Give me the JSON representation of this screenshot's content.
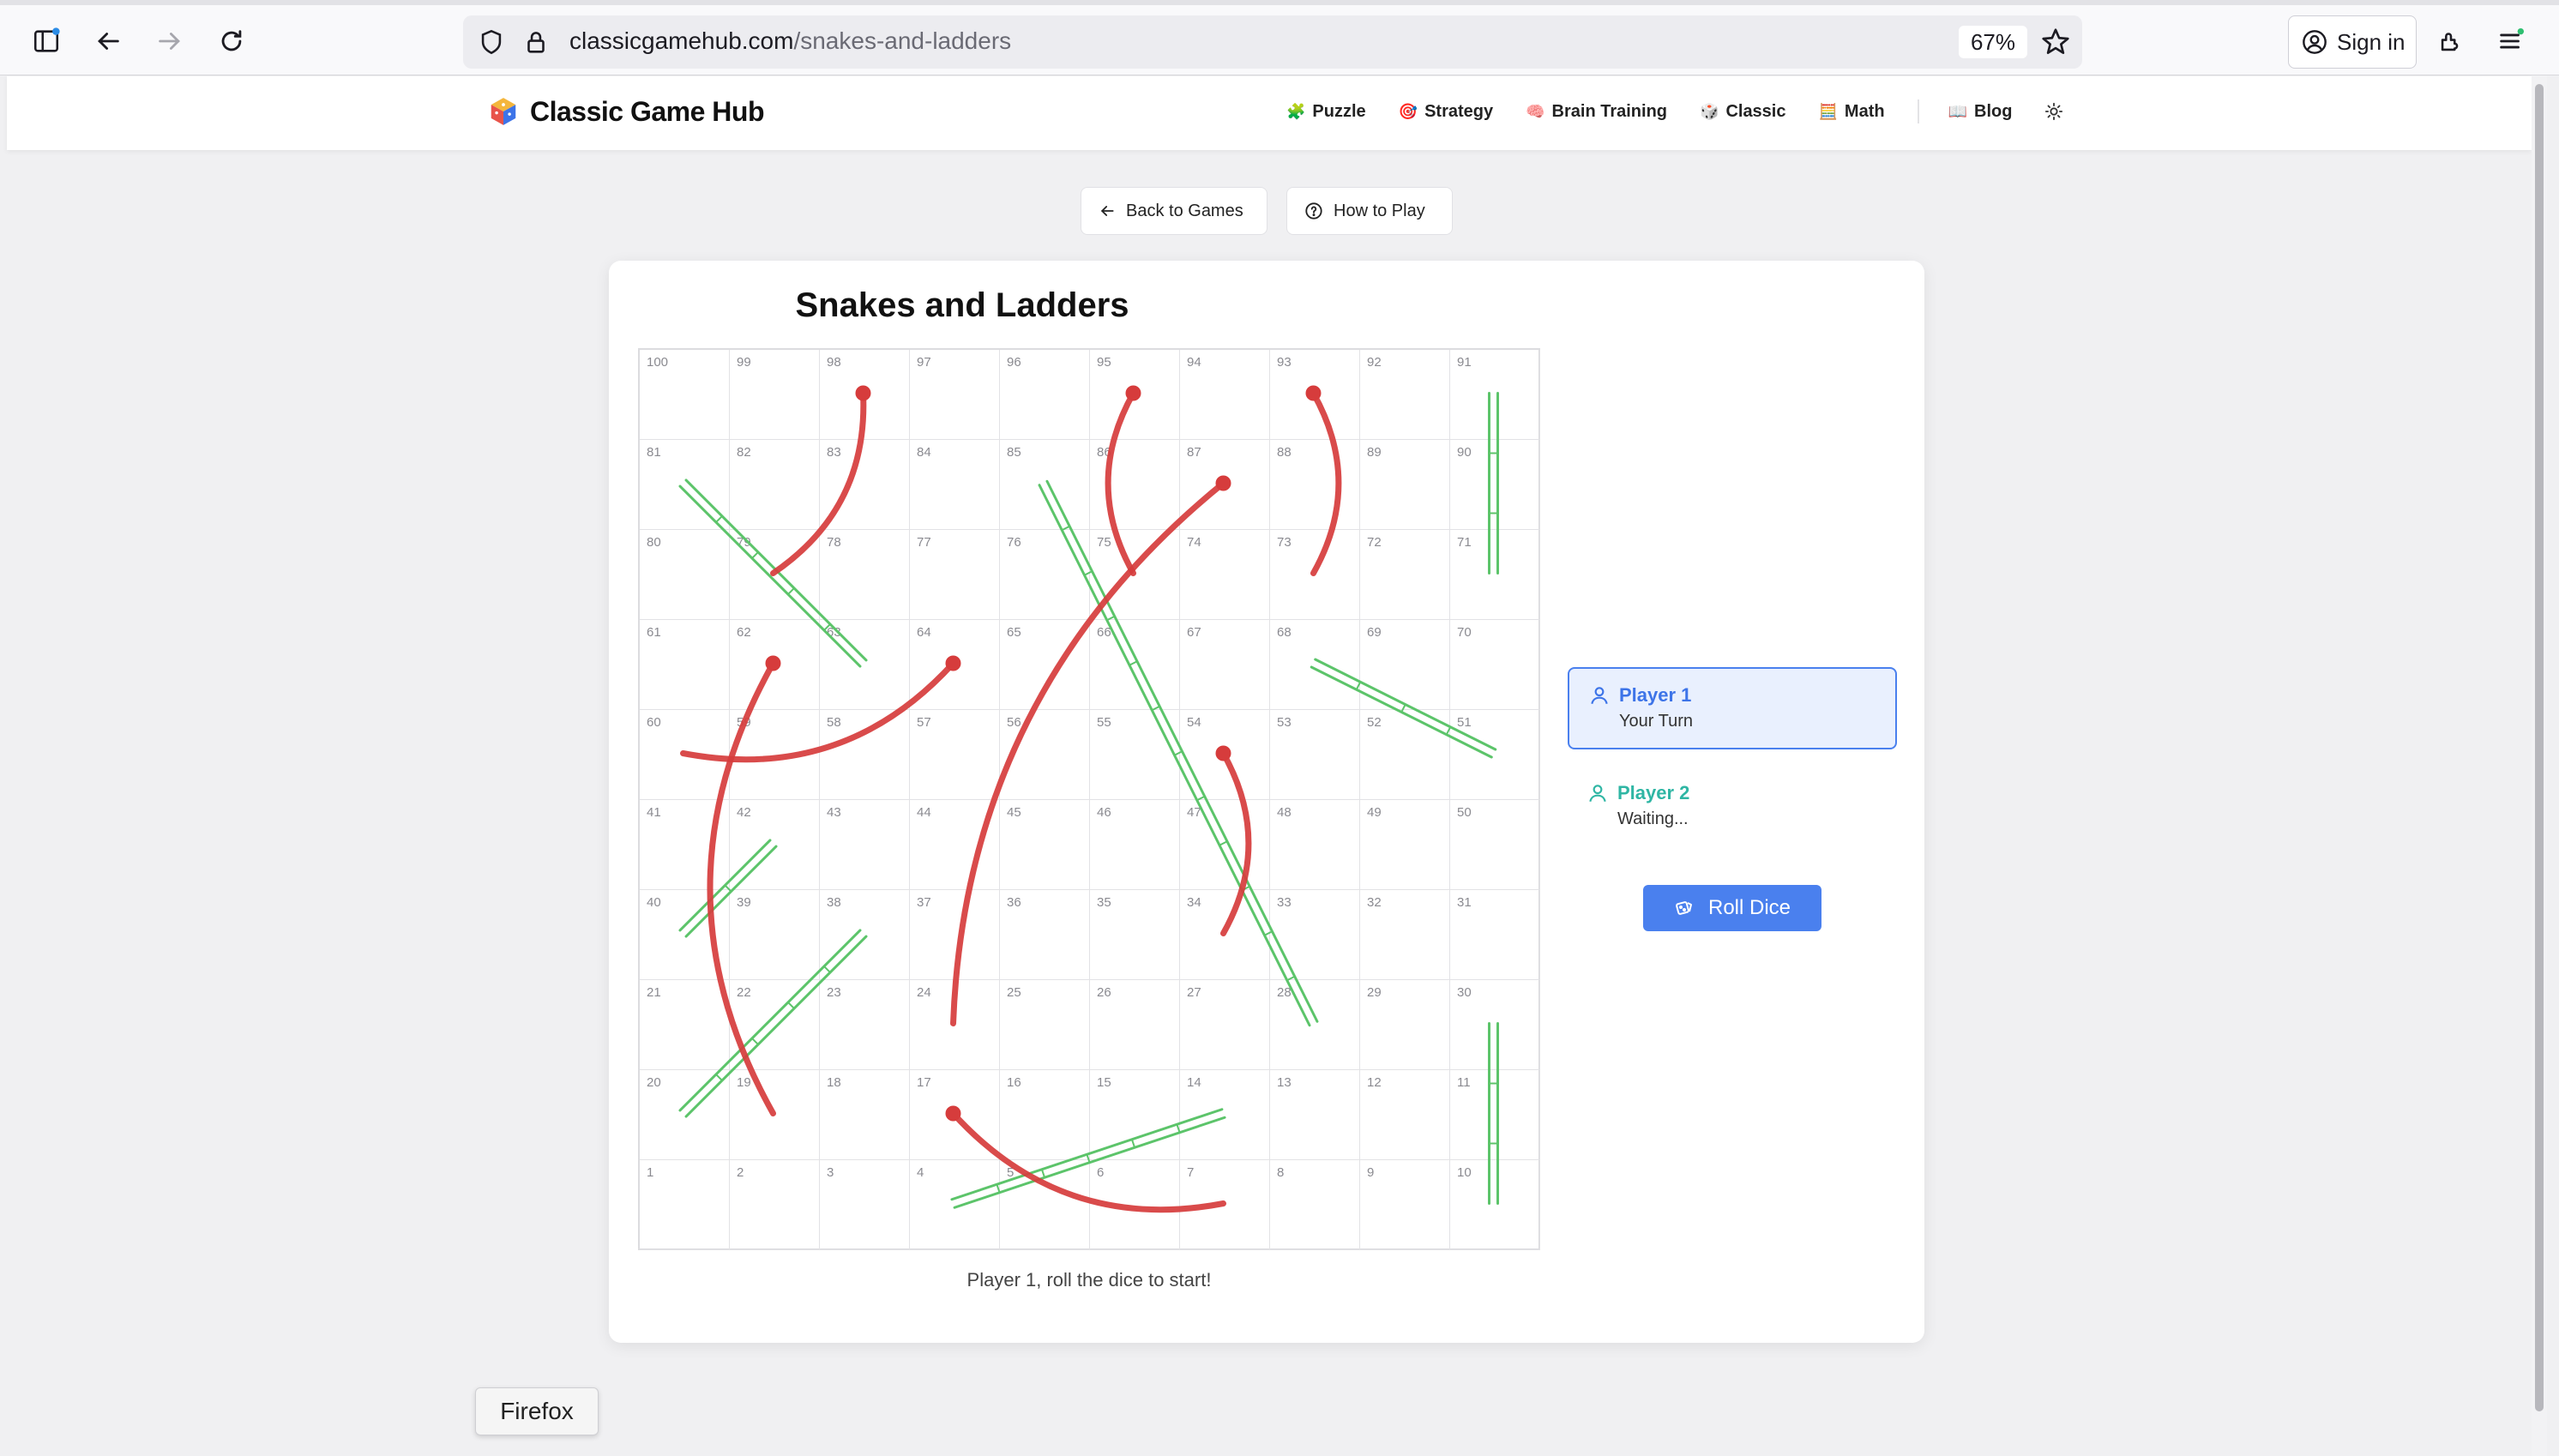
{
  "browser": {
    "url_host": "classicgamehub.com",
    "url_path": "/snakes-and-ladders",
    "zoom": "67%",
    "sign_in": "Sign in",
    "tooltip": "Firefox"
  },
  "site": {
    "logo_text": "Classic Game Hub",
    "nav": [
      {
        "label": "Puzzle",
        "emoji": "🧩"
      },
      {
        "label": "Strategy",
        "emoji": "🎯"
      },
      {
        "label": "Brain Training",
        "emoji": "🧠"
      },
      {
        "label": "Classic",
        "emoji": "🎲"
      },
      {
        "label": "Math",
        "emoji": "🧮"
      },
      {
        "label": "Blog",
        "emoji": "📖"
      }
    ]
  },
  "page": {
    "back_label": "Back to Games",
    "howto_label": "How to Play"
  },
  "game": {
    "title": "Snakes and Ladders",
    "status_message": "Player 1, roll the dice to start!",
    "roll_label": "Roll Dice",
    "players": [
      {
        "name": "Player 1",
        "status": "Your Turn",
        "color": "#3d74e8"
      },
      {
        "name": "Player 2",
        "status": "Waiting...",
        "color": "#2fb6a4"
      }
    ],
    "snake_color": "#d63c3c",
    "ladder_color": "#5cc46a",
    "board_rows": [
      [
        100,
        99,
        98,
        97,
        96,
        95,
        94,
        93,
        92,
        91
      ],
      [
        81,
        82,
        83,
        84,
        85,
        86,
        87,
        88,
        89,
        90
      ],
      [
        80,
        79,
        78,
        77,
        76,
        75,
        74,
        73,
        72,
        71
      ],
      [
        61,
        62,
        63,
        64,
        65,
        66,
        67,
        68,
        69,
        70
      ],
      [
        60,
        59,
        58,
        57,
        56,
        55,
        54,
        53,
        52,
        51
      ],
      [
        41,
        42,
        43,
        44,
        45,
        46,
        47,
        48,
        49,
        50
      ],
      [
        40,
        39,
        38,
        37,
        36,
        35,
        34,
        33,
        32,
        31
      ],
      [
        21,
        22,
        23,
        24,
        25,
        26,
        27,
        28,
        29,
        30
      ],
      [
        20,
        19,
        18,
        17,
        16,
        15,
        14,
        13,
        12,
        11
      ],
      [
        1,
        2,
        3,
        4,
        5,
        6,
        7,
        8,
        9,
        10
      ]
    ],
    "snakes": [
      {
        "head": 98,
        "tail": 79
      },
      {
        "head": 95,
        "tail": 75
      },
      {
        "head": 93,
        "tail": 73
      },
      {
        "head": 87,
        "tail": 24
      },
      {
        "head": 64,
        "tail": 60
      },
      {
        "head": 62,
        "tail": 19
      },
      {
        "head": 54,
        "tail": 34
      },
      {
        "head": 17,
        "tail": 7
      }
    ],
    "ladders": [
      {
        "from": 63,
        "to": 81
      },
      {
        "from": 28,
        "to": 85
      },
      {
        "from": 71,
        "to": 91
      },
      {
        "from": 51,
        "to": 68
      },
      {
        "from": 40,
        "to": 42
      },
      {
        "from": 20,
        "to": 38
      },
      {
        "from": 10,
        "to": 30
      },
      {
        "from": 4,
        "to": 14
      }
    ]
  }
}
